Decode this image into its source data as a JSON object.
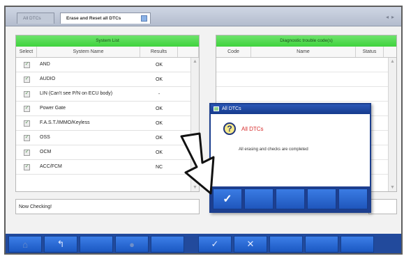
{
  "tabs": [
    {
      "label": "All DTCs"
    },
    {
      "label": "Erase and Reset all DTCs"
    }
  ],
  "system_list": {
    "title": "System List",
    "columns": [
      "Select",
      "System Name",
      "Results"
    ],
    "rows": [
      {
        "name": "AND",
        "result": "OK"
      },
      {
        "name": "AUDIO",
        "result": "OK"
      },
      {
        "name": "LIN (Can't see P/N on ECU body)",
        "result": "-"
      },
      {
        "name": "Power Gate",
        "result": "OK"
      },
      {
        "name": "F.A.S.T./IMMO/Keyless",
        "result": "OK"
      },
      {
        "name": "OSS",
        "result": "OK"
      },
      {
        "name": "OCM",
        "result": "OK"
      },
      {
        "name": "ACC/FCM",
        "result": "NC"
      }
    ]
  },
  "dtc_list": {
    "title": "Diagnostic trouble code(s)",
    "columns": [
      "Code",
      "Name",
      "Status"
    ]
  },
  "status_text": "Now Checking!",
  "dialog": {
    "title": "All DTCs",
    "heading": "All DTCs",
    "message": "All erasing and checks are completed",
    "ok_icon": "checkmark-icon"
  },
  "toolbar": {
    "icons": [
      "home-icon",
      "back-icon",
      "blank",
      "settings-icon",
      "blank",
      "checkmark-icon",
      "cross-icon",
      "blank",
      "blank",
      "blank",
      "blank"
    ]
  },
  "colors": {
    "header_green": "#3fd33d",
    "toolbar_blue": "#224a9c",
    "dialog_title": "#1c3f8e",
    "heading_red": "#d62b2b"
  }
}
